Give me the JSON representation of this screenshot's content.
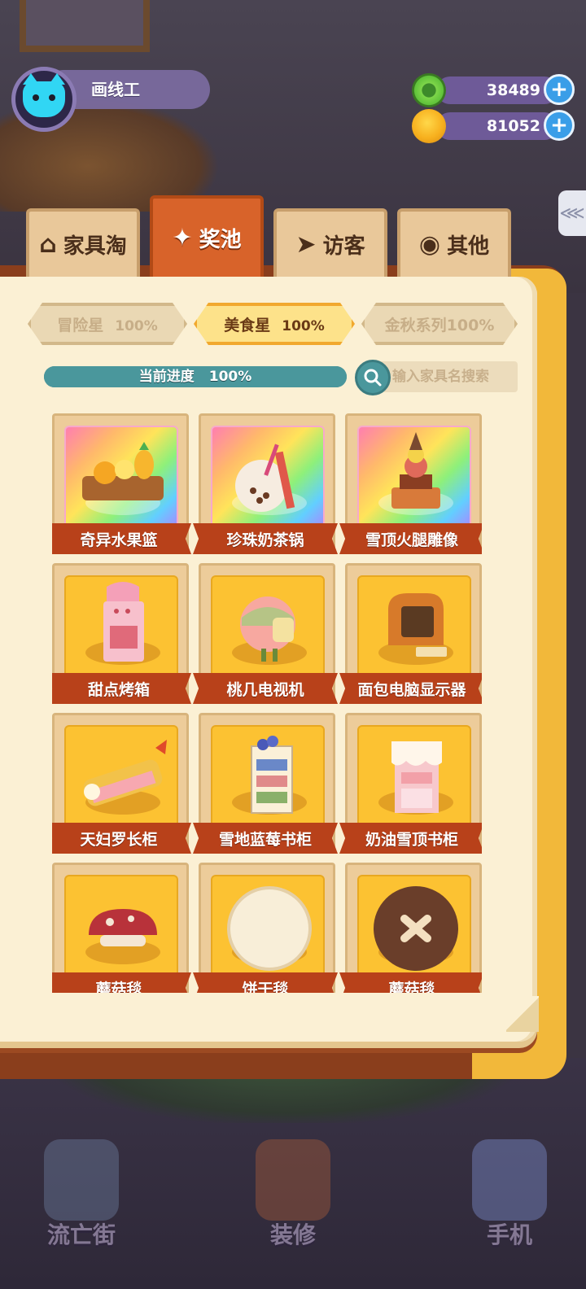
{
  "user": {
    "name": "画线工"
  },
  "currencies": [
    {
      "icon": "donut-coin-icon",
      "amount": "38489"
    },
    {
      "icon": "planet-coin-icon",
      "amount": "81052"
    }
  ],
  "tabs": [
    {
      "label": "家具淘",
      "icon": "house-icon"
    },
    {
      "label": "奖池",
      "icon": "star-cards-icon"
    },
    {
      "label": "访客",
      "icon": "paper-plane-icon"
    },
    {
      "label": "其他",
      "icon": "paw-icon"
    }
  ],
  "series": [
    {
      "name": "冒险星",
      "percent": "100%"
    },
    {
      "name": "美食星",
      "percent": "100%"
    },
    {
      "name": "金秋系列",
      "percent": "100%"
    }
  ],
  "progress": {
    "label": "当前进度",
    "percent_text": "100%",
    "value": 1.0
  },
  "search": {
    "placeholder": "输入家具名搜索"
  },
  "items": [
    {
      "name": "奇异水果篮",
      "rarity": "rainbow"
    },
    {
      "name": "珍珠奶茶锅",
      "rarity": "rainbow"
    },
    {
      "name": "雪顶火腿雕像",
      "rarity": "rainbow"
    },
    {
      "name": "甜点烤箱",
      "rarity": "gold"
    },
    {
      "name": "桃几电视机",
      "rarity": "gold"
    },
    {
      "name": "面包电脑显示器",
      "rarity": "gold"
    },
    {
      "name": "天妇罗长柜",
      "rarity": "gold"
    },
    {
      "name": "雪地蓝莓书柜",
      "rarity": "gold"
    },
    {
      "name": "奶油雪顶书柜",
      "rarity": "gold"
    },
    {
      "name": "蘑菇毯",
      "rarity": "gold"
    },
    {
      "name": "饼干毯",
      "rarity": "gold"
    },
    {
      "name": "蘑菇毯",
      "rarity": "gold"
    }
  ],
  "bottom_nav": [
    {
      "label": "流亡街"
    },
    {
      "label": "装修"
    },
    {
      "label": "手机"
    }
  ],
  "colors": {
    "active_tab": "#d8632a",
    "progress": "#4a979c",
    "ribbon": "#b8411a",
    "card_gold": "#fcc232"
  }
}
